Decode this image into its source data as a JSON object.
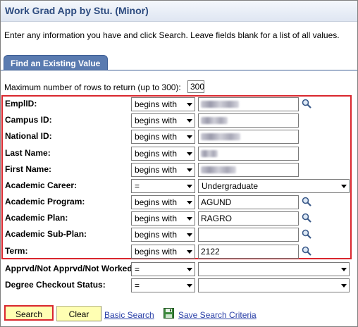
{
  "page": {
    "title": "Work Grad App by Stu. (Minor)",
    "instructions": "Enter any information you have and click Search. Leave fields blank for a list of all values.",
    "tab_label": "Find an Existing Value"
  },
  "max_rows": {
    "label": "Maximum number of rows to return (up to 300):",
    "value": "300"
  },
  "fields": [
    {
      "label": "EmplID:",
      "operator": "begins with",
      "value": "",
      "redacted": true,
      "lookup": true
    },
    {
      "label": "Campus ID:",
      "operator": "begins with",
      "value": "",
      "redacted": true,
      "lookup": false
    },
    {
      "label": "National ID:",
      "operator": "begins with",
      "value": "",
      "redacted": true,
      "lookup": false
    },
    {
      "label": "Last Name:",
      "operator": "begins with",
      "value": "",
      "redacted": true,
      "lookup": false
    },
    {
      "label": "First Name:",
      "operator": "begins with",
      "value": "",
      "redacted": true,
      "lookup": false
    },
    {
      "label": "Academic Career:",
      "operator": "=",
      "value": "Undergraduate",
      "type": "select"
    },
    {
      "label": "Academic Program:",
      "operator": "begins with",
      "value": "AGUND",
      "lookup": true
    },
    {
      "label": "Academic Plan:",
      "operator": "begins with",
      "value": "RAGRO",
      "lookup": true
    },
    {
      "label": "Academic Sub-Plan:",
      "operator": "begins with",
      "value": "",
      "lookup": true
    },
    {
      "label": "Term:",
      "operator": "begins with",
      "value": "2122",
      "lookup": true
    },
    {
      "label": "Apprvd/Not Apprvd/Not Worked:",
      "operator": "=",
      "value": "",
      "type": "select"
    },
    {
      "label": "Degree Checkout Status:",
      "operator": "=",
      "value": "",
      "type": "select"
    }
  ],
  "buttons": {
    "search": "Search",
    "clear": "Clear",
    "basic_search": "Basic Search",
    "save_search": "Save Search Criteria"
  },
  "colors": {
    "title": "#2d4b7f",
    "tab": "#5a7bb0",
    "highlight": "#d9272e",
    "button_bg": "#ffffb3",
    "link": "#2a40a8"
  },
  "icons": {
    "lookup": "magnifier-icon",
    "save": "floppy-disk-icon",
    "dropdown": "chevron-down-icon"
  }
}
